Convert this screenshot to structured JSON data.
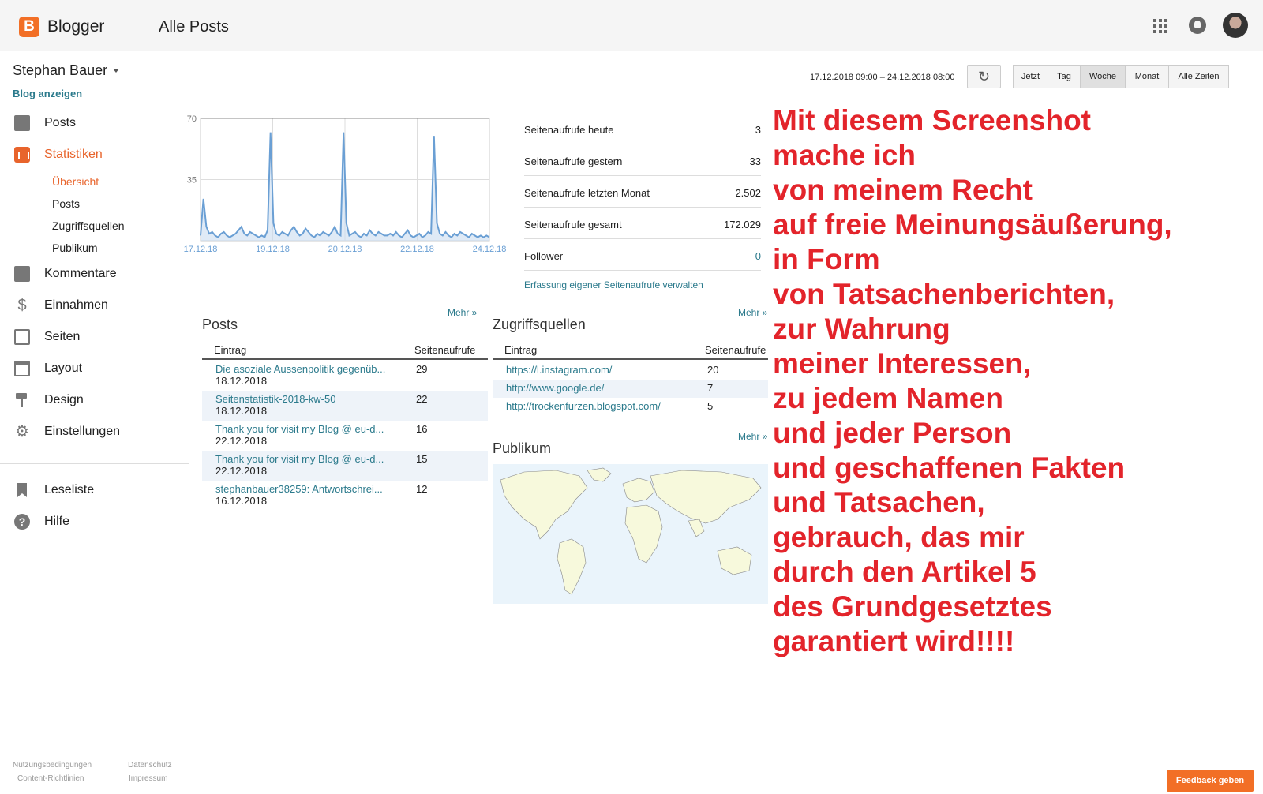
{
  "header": {
    "brand": "Blogger",
    "page_title": "Alle Posts"
  },
  "sidebar": {
    "user_name": "Stephan Bauer",
    "view_blog": "Blog anzeigen",
    "nav": [
      {
        "label": "Posts",
        "icon": "posts-icon"
      },
      {
        "label": "Statistiken",
        "icon": "stats-icon"
      },
      {
        "label": "Kommentare",
        "icon": "comments-icon"
      },
      {
        "label": "Einnahmen",
        "icon": "dollar-icon"
      },
      {
        "label": "Seiten",
        "icon": "pages-icon"
      },
      {
        "label": "Layout",
        "icon": "layout-icon"
      },
      {
        "label": "Design",
        "icon": "paint-roller-icon"
      },
      {
        "label": "Einstellungen",
        "icon": "gear-icon"
      }
    ],
    "stats_sub": [
      "Übersicht",
      "Posts",
      "Zugriffsquellen",
      "Publikum"
    ],
    "bottom_nav": [
      {
        "label": "Leseliste",
        "icon": "bookmark-icon"
      },
      {
        "label": "Hilfe",
        "icon": "help-icon"
      }
    ]
  },
  "footer": {
    "terms": "Nutzungsbedingungen",
    "privacy": "Datenschutz",
    "content_policy": "Content-Richtlinien",
    "imprint": "Impressum",
    "feedback": "Feedback geben"
  },
  "range": {
    "dates": "17.12.2018 09:00 – 24.12.2018 08:00",
    "buttons": [
      "Jetzt",
      "Tag",
      "Woche",
      "Monat",
      "Alle Zeiten"
    ],
    "active": "Woche"
  },
  "stats": {
    "rows": [
      {
        "label": "Seitenaufrufe heute",
        "value": "3"
      },
      {
        "label": "Seitenaufrufe gestern",
        "value": "33"
      },
      {
        "label": "Seitenaufrufe letzten Monat",
        "value": "2.502"
      },
      {
        "label": "Seitenaufrufe gesamt",
        "value": "172.029"
      },
      {
        "label": "Follower",
        "value": "0"
      }
    ],
    "manage_link": "Erfassung eigener Seitenaufrufe verwalten"
  },
  "posts_panel": {
    "title": "Posts",
    "more": "Mehr »",
    "col_entry": "Eintrag",
    "col_views": "Seitenaufrufe",
    "rows": [
      {
        "title": "Die asoziale Aussenpolitik gegenüb...",
        "date": "18.12.2018",
        "views": "29"
      },
      {
        "title": "Seitenstatistik-2018-kw-50",
        "date": "18.12.2018",
        "views": "22"
      },
      {
        "title": "Thank you for visit my Blog @ eu-d...",
        "date": "22.12.2018",
        "views": "16"
      },
      {
        "title": "Thank you for visit my Blog @ eu-d...",
        "date": "22.12.2018",
        "views": "15"
      },
      {
        "title": "stephanbauer38259: Antwortschrei...",
        "date": "16.12.2018",
        "views": "12"
      }
    ]
  },
  "sources_panel": {
    "title": "Zugriffsquellen",
    "more": "Mehr »",
    "col_entry": "Eintrag",
    "col_views": "Seitenaufrufe",
    "rows": [
      {
        "url": "https://l.instagram.com/",
        "views": "20"
      },
      {
        "url": "http://www.google.de/",
        "views": "7"
      },
      {
        "url": "http://trockenfurzen.blogspot.com/",
        "views": "5"
      }
    ]
  },
  "audience_panel": {
    "title": "Publikum",
    "more": "Mehr »"
  },
  "overlay_text": [
    "Mit diesem Screenshot",
    "mache ich",
    "von meinem Recht",
    "auf freie Meinungsäußerung,",
    "in Form",
    "von Tatsachenberichten,",
    "zur Wahrung",
    "meiner Interessen,",
    "zu jedem Namen",
    "und jeder Person",
    "und geschaffenen Fakten",
    "und Tatsachen,",
    "gebrauch, das mir",
    "durch den Artikel 5",
    "des Grundgesetztes",
    "garantiert wird!!!!"
  ],
  "colors": {
    "accent": "#e8642c",
    "link": "#2b7a8c",
    "chart_line": "#6a9fd4",
    "overlay": "#e3242b"
  },
  "chart_data": {
    "type": "area",
    "xlabels": [
      "17.12.18",
      "19.12.18",
      "20.12.18",
      "22.12.18",
      "24.12.18"
    ],
    "ylabels": [
      "70",
      "35"
    ],
    "ylim": [
      0,
      70
    ],
    "values": [
      3,
      24,
      8,
      4,
      5,
      3,
      2,
      4,
      5,
      3,
      2,
      3,
      4,
      6,
      8,
      4,
      3,
      5,
      4,
      3,
      2,
      3,
      2,
      6,
      62,
      10,
      4,
      3,
      5,
      4,
      3,
      6,
      8,
      5,
      3,
      4,
      7,
      5,
      3,
      2,
      4,
      3,
      5,
      4,
      3,
      5,
      8,
      4,
      3,
      62,
      10,
      3,
      4,
      5,
      3,
      2,
      4,
      3,
      6,
      4,
      3,
      5,
      4,
      3,
      3,
      4,
      3,
      5,
      3,
      2,
      4,
      6,
      3,
      2,
      3,
      4,
      2,
      3,
      5,
      4,
      60,
      10,
      4,
      3,
      5,
      3,
      2,
      4,
      3,
      5,
      4,
      3,
      2,
      4,
      3,
      2,
      3,
      2,
      3,
      2
    ]
  }
}
